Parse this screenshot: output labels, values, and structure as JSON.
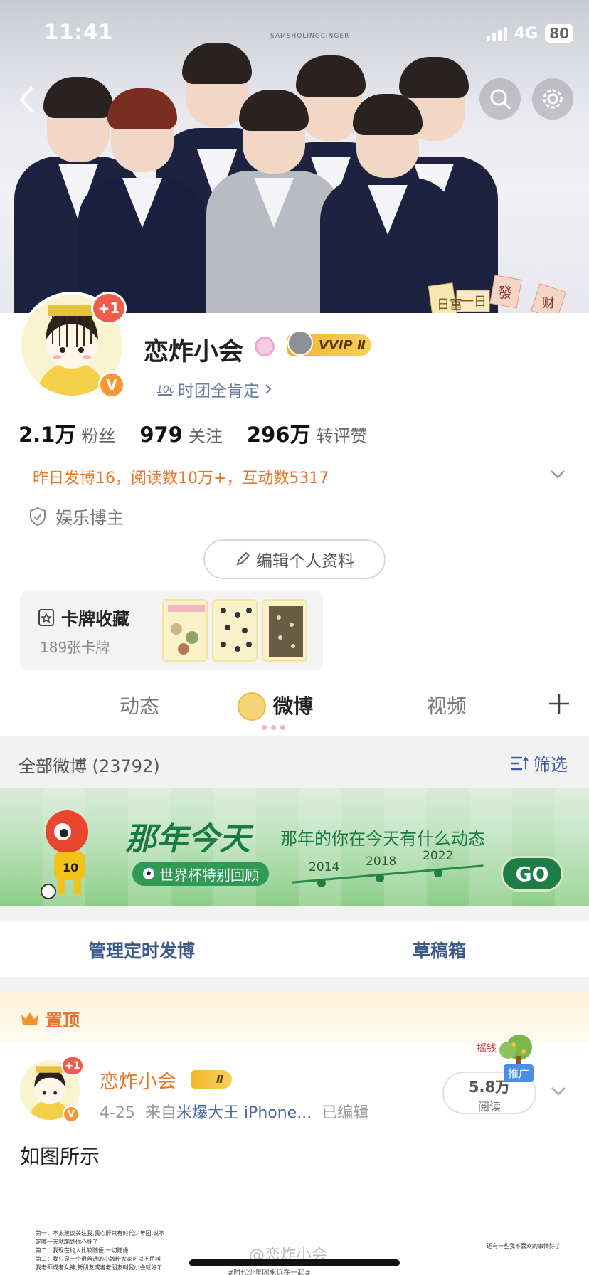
{
  "status_bar": {
    "time": "11:41",
    "network": "4G",
    "battery": "80"
  },
  "banner": {
    "tag": "SAMSHOLINGCINGER",
    "sticker_text_1": "日富",
    "sticker_text_2": "一日",
    "sticker_text_3": "發",
    "sticker_text_4": "财"
  },
  "profile": {
    "name": "恋炸小会",
    "avatar_badge": "+1",
    "verified_badge": "V",
    "vvip_label": "VVIP Ⅱ",
    "group_label": "时团全肯定",
    "stats": [
      {
        "value": "2.1万",
        "label": "粉丝"
      },
      {
        "value": "979",
        "label": "关注"
      },
      {
        "value": "296万",
        "label": "转评赞"
      }
    ],
    "summary": "昨日发博16，阅读数10万+，互动数5317",
    "blogger_type": "娱乐博主",
    "edit_button": "编辑个人资料",
    "cards": {
      "title": "卡牌收藏",
      "count": "189张卡牌"
    }
  },
  "tabs": [
    {
      "label": "动态",
      "active": false
    },
    {
      "label": "微博",
      "active": true
    },
    {
      "label": "视频",
      "active": false
    }
  ],
  "feed": {
    "all_label": "全部微博 (23792)",
    "filter_label": "筛选",
    "promo": {
      "title": "那年今天",
      "subtitle": "那年的你在今天有什么动态",
      "badge": "世界杯特别回顾",
      "years": [
        "2014",
        "2018",
        "2022"
      ],
      "go": "GO",
      "mascot_number": "10"
    },
    "actions": [
      "管理定时发博",
      "草稿箱"
    ]
  },
  "post": {
    "pin_label": "置顶",
    "author": "恋炸小会",
    "avatar_badge": "+1",
    "verified_badge": "V",
    "badge_label": "Ⅱ",
    "date": "4-25",
    "source_prefix": "来自",
    "source": "米爆大王 iPhone...",
    "edited": "已编辑",
    "reads": "5.8万",
    "reads_label": "阅读",
    "promo_tag": "推广",
    "tree_label": "摇钱",
    "text": "如图所示",
    "image_lines": [
      "第一：不太建议关注我,我心肝只有时代少年团,说不",
      "定哪一天就蹦到你心肝了",
      "第二：我现在约人比较随便,一切随缘",
      "第三：我只是一个很普通的小散粉大家可以不用叫",
      "我老师或者女神,新朋友或者老朋友叫我小会就好了"
    ],
    "image_right": "还有一些我不喜欢的事情好了",
    "watermark": "@恋炸小会",
    "hashtag": "#时代少年团永远在一起#"
  }
}
